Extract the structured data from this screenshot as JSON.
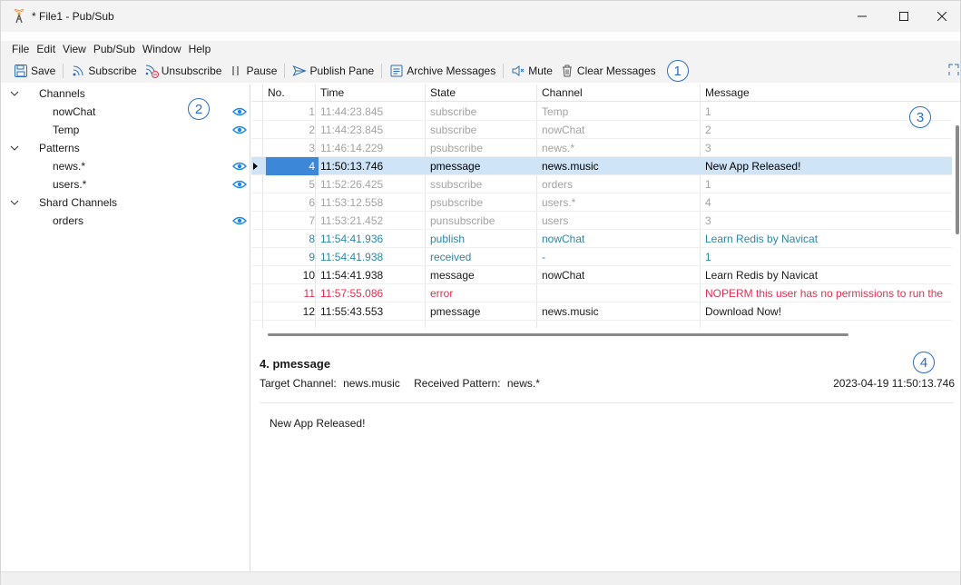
{
  "window": {
    "title": "* File1 - Pub/Sub"
  },
  "menu": [
    "File",
    "Edit",
    "View",
    "Pub/Sub",
    "Window",
    "Help"
  ],
  "toolbar": {
    "save": "Save",
    "subscribe": "Subscribe",
    "unsubscribe": "Unsubscribe",
    "pause": "Pause",
    "publish_pane": "Publish Pane",
    "archive": "Archive Messages",
    "mute": "Mute",
    "clear": "Clear Messages"
  },
  "markers": [
    "1",
    "2",
    "3",
    "4"
  ],
  "tree": [
    {
      "label": "Channels",
      "kind": "group"
    },
    {
      "label": "nowChat",
      "kind": "item"
    },
    {
      "label": "Temp",
      "kind": "item"
    },
    {
      "label": "Patterns",
      "kind": "group"
    },
    {
      "label": "news.*",
      "kind": "item"
    },
    {
      "label": "users.*",
      "kind": "item"
    },
    {
      "label": "Shard Channels",
      "kind": "group"
    },
    {
      "label": "orders",
      "kind": "item"
    }
  ],
  "grid": {
    "columns": [
      "No.",
      "Time",
      "State",
      "Channel",
      "Message"
    ],
    "rows": [
      {
        "no": "1",
        "time": "11:44:23.845",
        "state": "subscribe",
        "channel": "Temp",
        "message": "1",
        "style": "gray"
      },
      {
        "no": "2",
        "time": "11:44:23.845",
        "state": "subscribe",
        "channel": "nowChat",
        "message": "2",
        "style": "gray"
      },
      {
        "no": "3",
        "time": "11:46:14.229",
        "state": "psubscribe",
        "channel": "news.*",
        "message": "3",
        "style": "gray"
      },
      {
        "no": "4",
        "time": "11:50:13.746",
        "state": "pmessage",
        "channel": "news.music",
        "message": "New App Released!",
        "style": "sel"
      },
      {
        "no": "5",
        "time": "11:52:26.425",
        "state": "ssubscribe",
        "channel": "orders",
        "message": "1",
        "style": "gray"
      },
      {
        "no": "6",
        "time": "11:53:12.558",
        "state": "psubscribe",
        "channel": "users.*",
        "message": "4",
        "style": "gray"
      },
      {
        "no": "7",
        "time": "11:53:21.452",
        "state": "punsubscribe",
        "channel": "users",
        "message": "3",
        "style": "gray"
      },
      {
        "no": "8",
        "time": "11:54:41.936",
        "state": "publish",
        "channel": "nowChat",
        "message": "Learn Redis by Navicat",
        "style": "teal"
      },
      {
        "no": "9",
        "time": "11:54:41.938",
        "state": "received",
        "channel": "-",
        "message": "1",
        "style": "teal"
      },
      {
        "no": "10",
        "time": "11:54:41.938",
        "state": "message",
        "channel": "nowChat",
        "message": "Learn Redis by Navicat",
        "style": "normal"
      },
      {
        "no": "11",
        "time": "11:57:55.086",
        "state": "error",
        "channel": "",
        "message": "NOPERM this user has no permissions to run the",
        "style": "red"
      },
      {
        "no": "12",
        "time": "11:55:43.553",
        "state": "pmessage",
        "channel": "news.music",
        "message": "Download Now!",
        "style": "normal"
      }
    ]
  },
  "detail": {
    "title": "4.  pmessage",
    "target_label": "Target Channel:",
    "target_value": "news.music",
    "pattern_label": "Received Pattern:",
    "pattern_value": "news.*",
    "timestamp": "2023-04-19 11:50:13.746",
    "body": "New App Released!"
  },
  "colors": {
    "accent": "#2a6cc4",
    "selection": "#cfe4f7",
    "teal": "#2b87a8",
    "error": "#e0304d",
    "eye": "#1e88e5"
  }
}
